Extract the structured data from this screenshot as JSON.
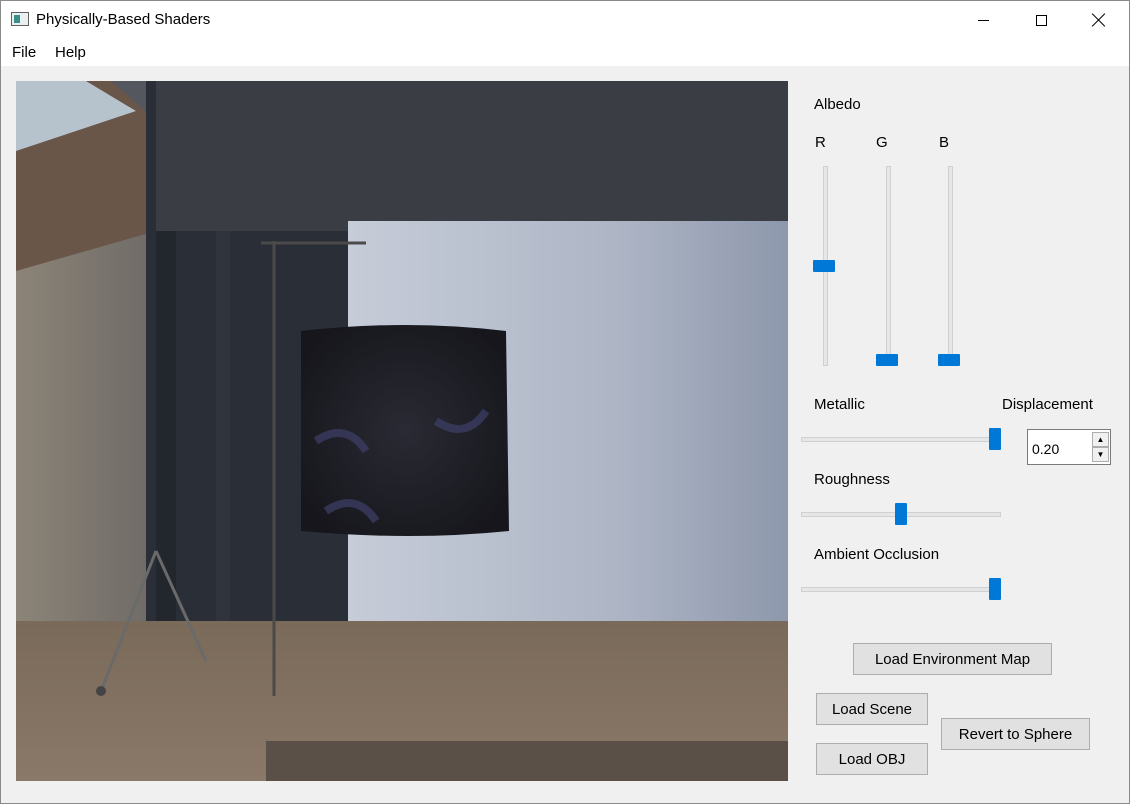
{
  "window": {
    "title": "Physically-Based Shaders"
  },
  "menu": {
    "items": [
      "File",
      "Help"
    ]
  },
  "controls": {
    "albedo_label": "Albedo",
    "channels": [
      {
        "label": "R",
        "value": 0.5
      },
      {
        "label": "G",
        "value": 0.0
      },
      {
        "label": "B",
        "value": 0.0
      }
    ],
    "metallic": {
      "label": "Metallic",
      "value": 1.0
    },
    "displacement": {
      "label": "Displacement",
      "value": "0.20"
    },
    "roughness": {
      "label": "Roughness",
      "value": 0.5
    },
    "ambient_occlusion": {
      "label": "Ambient Occlusion",
      "value": 1.0
    }
  },
  "buttons": {
    "load_env_map": "Load Environment Map",
    "load_scene": "Load Scene",
    "load_obj": "Load OBJ",
    "revert_sphere": "Revert to Sphere"
  },
  "colors": {
    "accent": "#0078d7",
    "panel_bg": "#f0f0f0",
    "button_bg": "#e1e1e1"
  }
}
